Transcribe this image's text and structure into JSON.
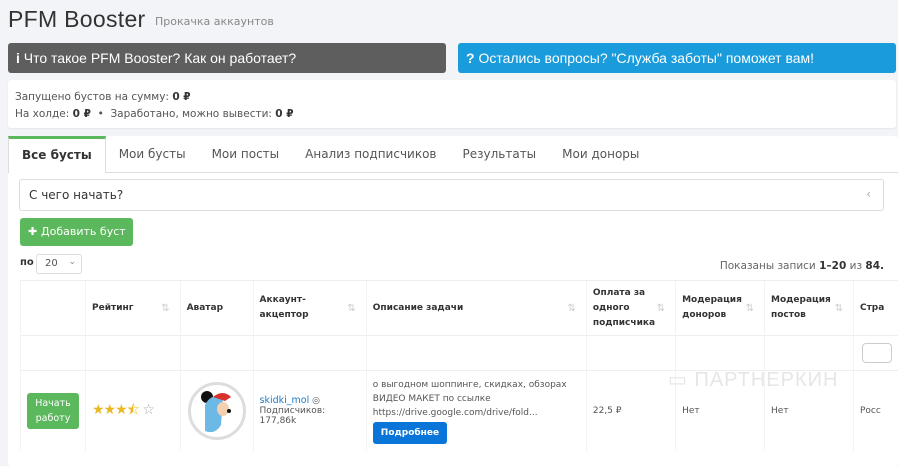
{
  "header": {
    "title": "PFM Booster",
    "subtitle": "Прокачка аккаунтов"
  },
  "banners": {
    "info": "Что такое PFM Booster? Как он работает?",
    "help": "Остались вопросы? \"Служба заботы\" поможет вам!"
  },
  "stats": {
    "launched_label": "Запущено бустов на сумму:",
    "launched_value": "0 ₽",
    "hold_label": "На холде:",
    "hold_value": "0 ₽",
    "earned_label": "Заработано, можно вывести:",
    "earned_value": "0 ₽"
  },
  "tabs": [
    "Все бусты",
    "Мои бусты",
    "Мои посты",
    "Анализ подписчиков",
    "Результаты",
    "Мои доноры"
  ],
  "accordion": {
    "label": "С чего начать?"
  },
  "add_button": "Добавить буст",
  "pagination": {
    "per_page_label": "по",
    "per_page": "20",
    "summary_prefix": "Показаны записи",
    "range": "1–20",
    "of": "из",
    "total": "84."
  },
  "table": {
    "headers": [
      "",
      "Рейтинг",
      "Аватар",
      "Аккаунт-акцептор",
      "Описание задачи",
      "Оплата за одного подписчика",
      "Модерация доноров",
      "Модерация постов",
      "Стра"
    ],
    "rows": [
      {
        "action": "Начать работу",
        "rating": 3.5,
        "account": "skidki_mol",
        "subscribers": "Подписчиков: 177,86k",
        "description": [
          "о выгодном шоппинге, скидках, обзорах",
          "ВИДЕО МАКЕТ по ссылке",
          "https://drive.google.com/drive/fold..."
        ],
        "more": "Подробнее",
        "price": "22,5 ₽",
        "donor_moderation": "Нет",
        "post_moderation": "Нет",
        "country": "Росс"
      }
    ]
  },
  "watermark": "ПАРТНЕРКИН",
  "colors": {
    "green": "#5cb85c",
    "blue": "#1a9bdc",
    "dark": "#5e5e5e"
  }
}
